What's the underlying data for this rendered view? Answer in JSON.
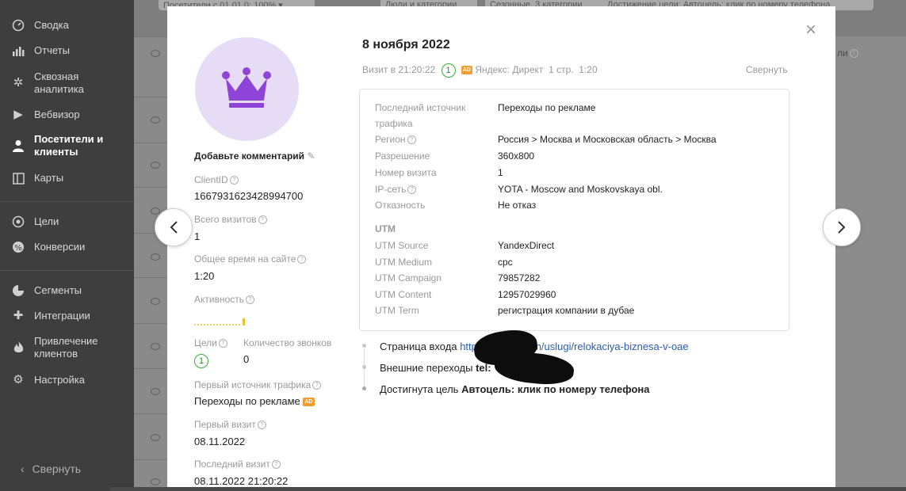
{
  "sidebar": {
    "items": [
      {
        "label": "Сводка",
        "icon": "dashboard-icon"
      },
      {
        "label": "Отчеты",
        "icon": "bar-chart-icon"
      },
      {
        "label": "Сквозная аналитика",
        "icon": "end-to-end-analytics-icon"
      },
      {
        "label": "Вебвизор",
        "icon": "play-icon"
      },
      {
        "label": "Посетители и клиенты",
        "icon": "user-icon"
      },
      {
        "label": "Карты",
        "icon": "map-icon"
      },
      {
        "label": "Цели",
        "icon": "target-icon"
      },
      {
        "label": "Конверсии",
        "icon": "conversion-icon"
      },
      {
        "label": "Сегменты",
        "icon": "pie-icon"
      },
      {
        "label": "Интеграции",
        "icon": "puzzle-icon"
      },
      {
        "label": "Привлечение клиентов",
        "icon": "flame-icon"
      },
      {
        "label": "Настройка",
        "icon": "gear-icon"
      }
    ],
    "collapse_label": "Свернуть"
  },
  "background": {
    "filter_chips": [
      "Посетители с 01.01.0: 100% ▾",
      "Люди и категории",
      "Сезонные, 3 категории",
      "Достижение цели: Автоцель: клик по номеру телефона"
    ],
    "right_column_header": "ли"
  },
  "modal": {
    "date_title": "8 ноября 2022",
    "visit_info": {
      "time": "Визит в 21:20:22",
      "visit_count": "1",
      "ad_badge": "AD",
      "source": "Яндекс: Директ",
      "pages": "1 стр.",
      "duration": "1:20",
      "collapse_link": "Свернуть"
    },
    "profile": {
      "comment": "Добавьте комментарий",
      "client_id_label": "ClientID",
      "client_id": "1667931623428994700",
      "total_visits_label": "Всего визитов",
      "total_visits": "1",
      "total_time_label": "Общее время на сайте",
      "total_time": "1:20",
      "activity_label": "Активность",
      "goals_label": "Цели",
      "goals_value": "1",
      "calls_label": "Количество звонков",
      "calls_value": "0",
      "first_source_label": "Первый источник трафика",
      "first_source": "Переходы по рекламе",
      "ad_badge": "AD",
      "first_visit_label": "Первый визит",
      "first_visit": "08.11.2022",
      "last_visit_label": "Последний визит",
      "last_visit": "08.11.2022 21:20:22"
    },
    "details": [
      {
        "key": "Последний источник трафика",
        "value": "Переходы по рекламе"
      },
      {
        "key": "Регион",
        "value": "Россия > Москва и Московская область > Москва"
      },
      {
        "key": "Разрешение",
        "value": "360x800"
      },
      {
        "key": "Номер визита",
        "value": "1"
      },
      {
        "key": "IP-сеть",
        "value": "YOTA - Moscow and Moskovskaya obl."
      },
      {
        "key": "Отказность",
        "value": "Не отказ"
      }
    ],
    "utm_heading": "UTM",
    "utm": [
      {
        "key": "UTM Source",
        "value": "YandexDirect"
      },
      {
        "key": "UTM Medium",
        "value": "cpc"
      },
      {
        "key": "UTM Campaign",
        "value": "79857282"
      },
      {
        "key": "UTM Content",
        "value": "12957029960"
      },
      {
        "key": "UTM Term",
        "value": "регистрация компании в дубае"
      }
    ],
    "timeline": {
      "entry_label": "Страница входа",
      "entry_url_start": "https",
      "entry_url_end": "com/uslugi/relokaciya-biznesa-v-oae",
      "external_label": "Внешние переходы",
      "external_value": "tel:",
      "goal_label": "Достигнута цель",
      "goal_value": "Автоцель: клик по номеру телефона"
    }
  },
  "colors": {
    "accent_purple": "#8e44d6",
    "link_blue": "#2a5db0",
    "ad_orange": "#f39c2f",
    "green": "#3cab3c"
  }
}
